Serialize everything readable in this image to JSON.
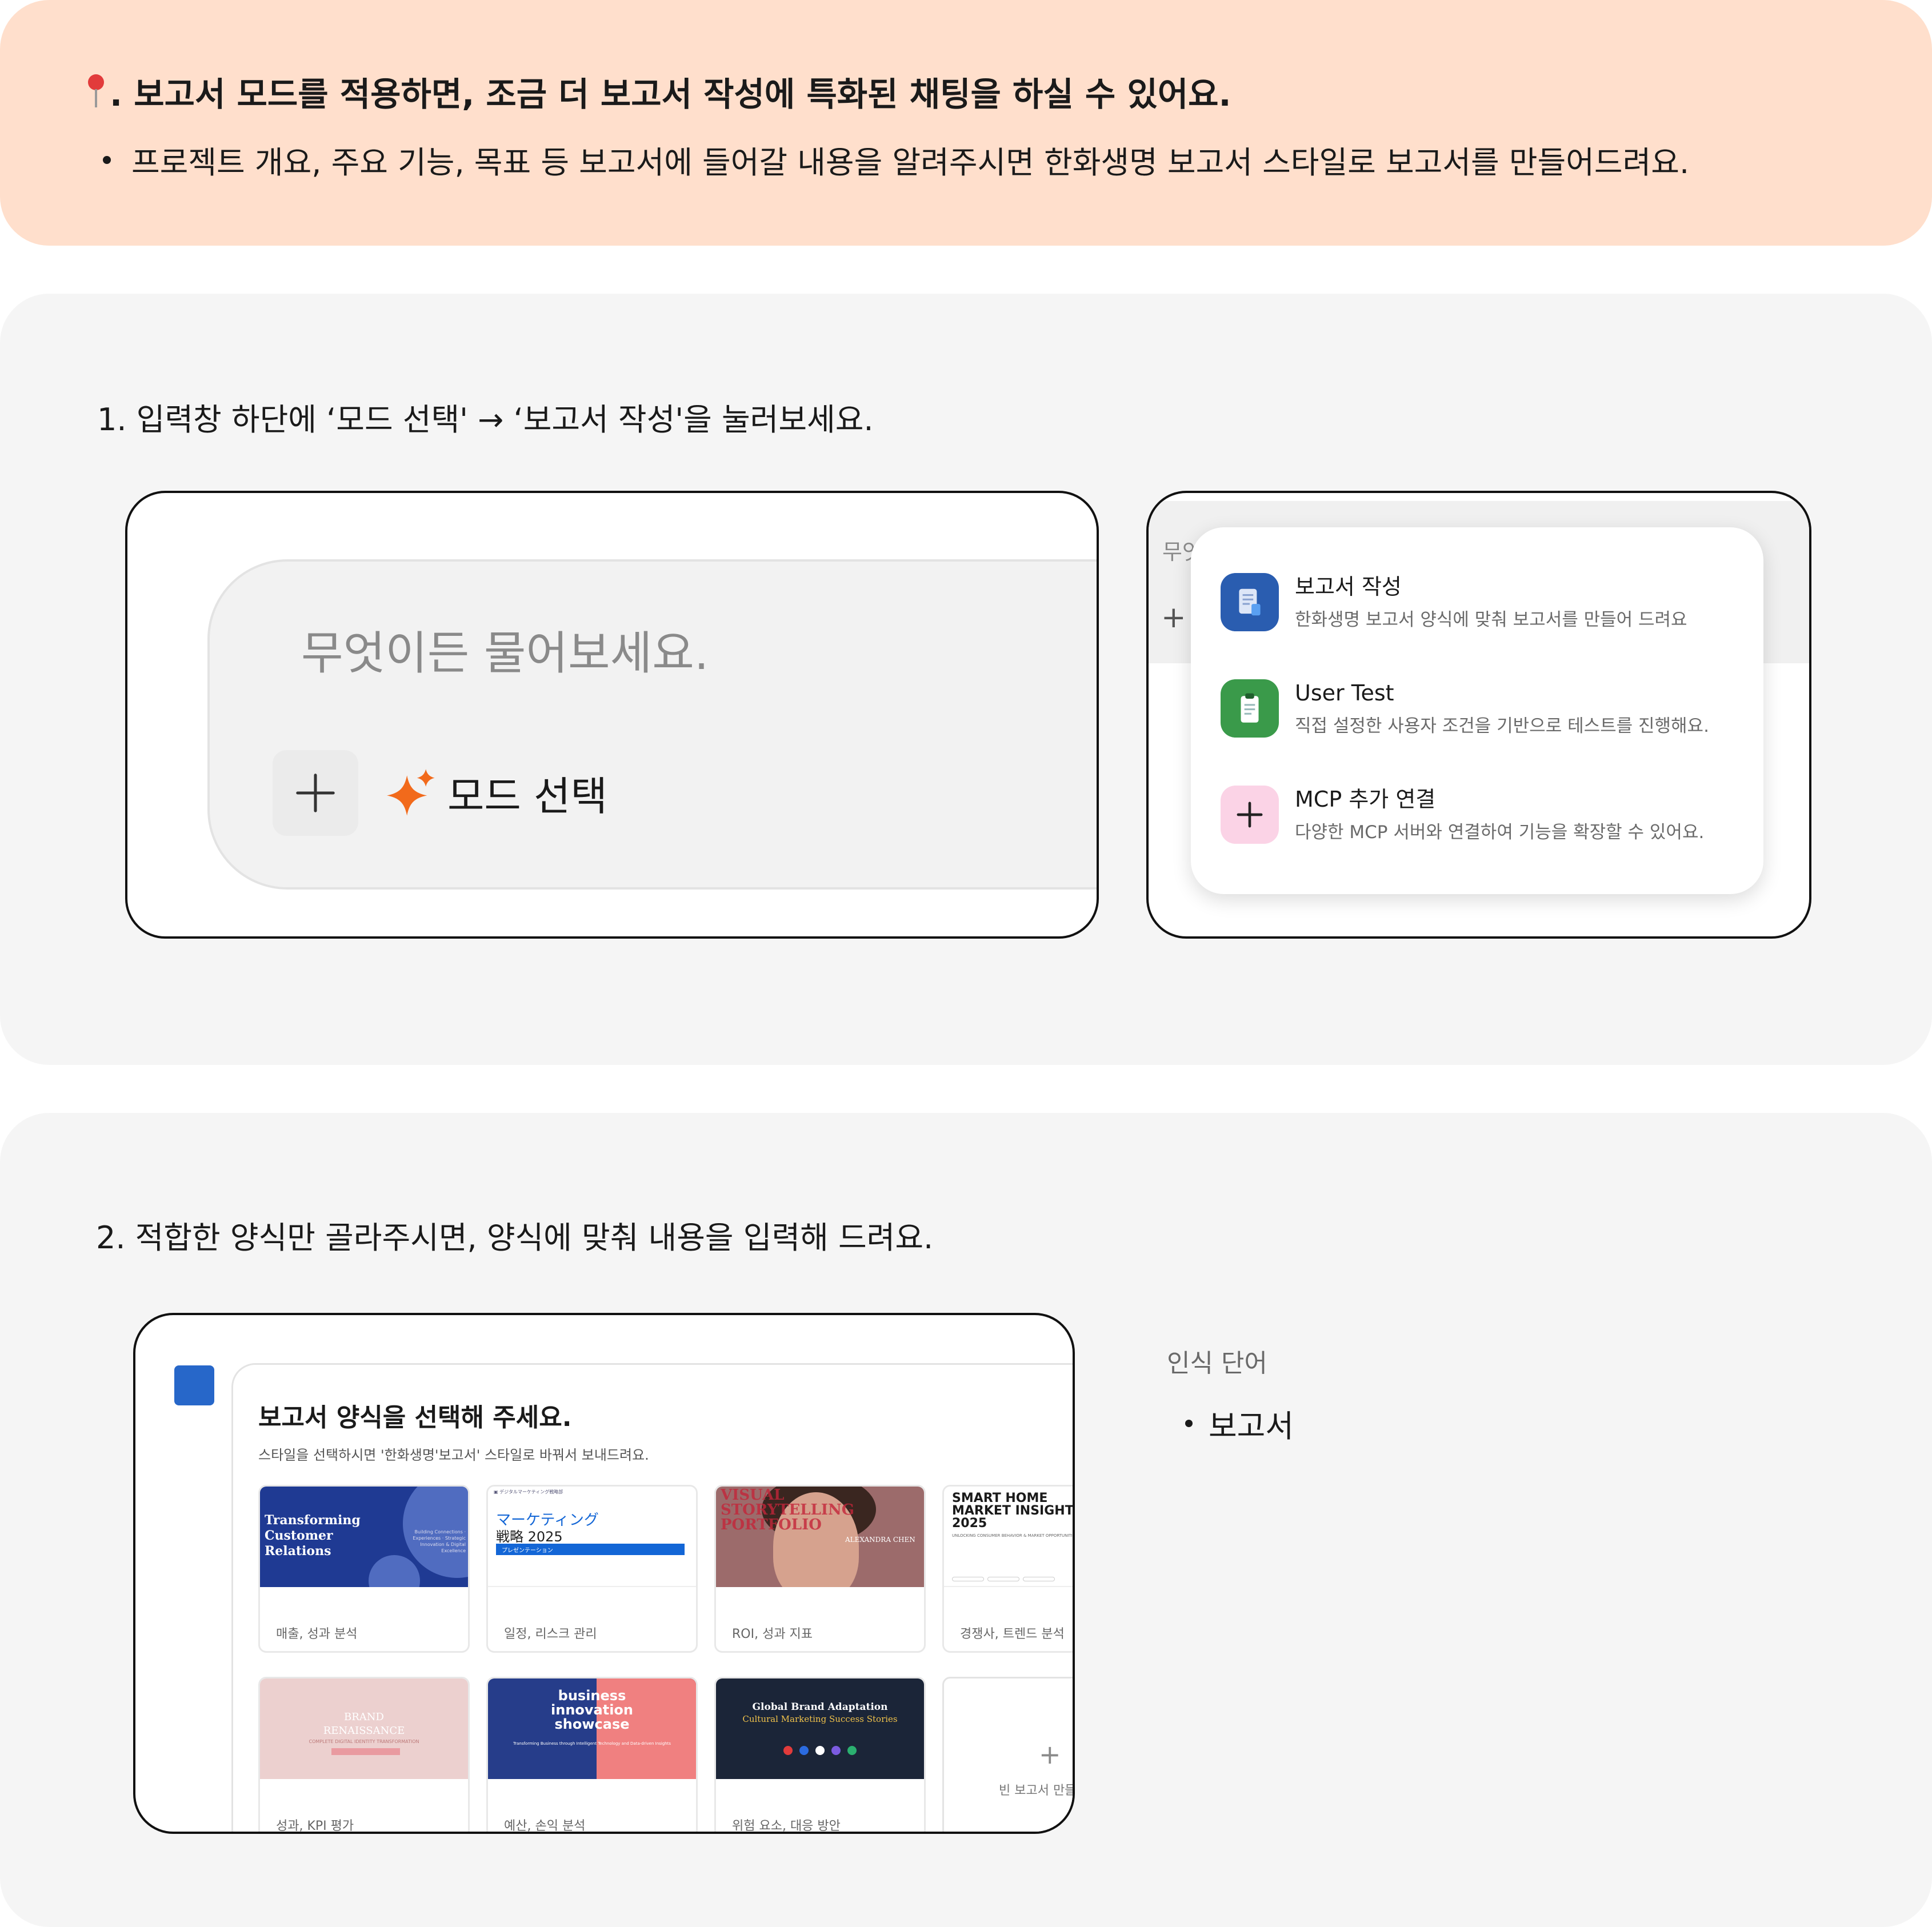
{
  "banner": {
    "title": ". 보고서 모드를 적용하면, 조금 더 보고서 작성에 특화된 채팅을 하실 수 있어요.",
    "bullet": "프로젝트 개요, 주요 기능, 목표 등 보고서에 들어갈 내용을 알려주시면 한화생명 보고서 스타일로 보고서를 만들어드려요."
  },
  "step1": {
    "text": "1. 입력창 하단에 ‘모드 선택' → ‘보고서 작성'을 눌러보세요.",
    "input_placeholder": "무엇이든 물어보세요.",
    "mode_button_label": "모드 선택",
    "bg_text": "무엇",
    "menu": [
      {
        "title": "보고서 작성",
        "desc": "한화생명 보고서 양식에 맞춰 보고서를 만들어 드려요",
        "color": "#2a5db0",
        "icon": "document-icon"
      },
      {
        "title": "User Test",
        "desc": "직접 설정한 사용자 조건을 기반으로 테스트를 진행해요.",
        "color": "#3a9a4a",
        "icon": "clipboard-icon"
      },
      {
        "title": "MCP 추가 연결",
        "desc": "다양한 MCP 서버와 연결하여 기능을 확장할 수 있어요.",
        "color": "#fbd3e6",
        "icon": "plus-icon"
      }
    ]
  },
  "step2": {
    "text": "2. 적합한 양식만 골라주시면, 양식에 맞춰 내용을 입력해 드려요.",
    "picker_title": "보고서 양식을 선택해 주세요.",
    "picker_subtitle": "스타일을 선택하시면 '한화생명'보고서' 스타일로 바꿔서 보내드려요.",
    "templates": [
      {
        "label": "매출, 성과 분석",
        "thumb_text": "Transforming\nCustomer\nRelations"
      },
      {
        "label": "일정, 리스크 관리",
        "thumb_text_1": "マーケティング",
        "thumb_text_2": "戦略 2025",
        "thumb_bar": "プレゼンテーション"
      },
      {
        "label": "ROI, 성과 지표",
        "thumb_text": "VISUAL\nSTORYTELLING\nPORTFOLIO",
        "thumb_name": "ALEXANDRA CHEN"
      },
      {
        "label": "경쟁사, 트렌드 분석",
        "thumb_text": "SMART HOME\nMARKET INSIGHTS\n2025"
      },
      {
        "label": "성과, KPI 평가",
        "thumb_text": "BRAND\nRENAISSANCE",
        "thumb_sub": "COMPLETE DIGITAL IDENTITY TRANSFORMATION"
      },
      {
        "label": "예산, 손익 분석",
        "thumb_text": "business\ninnovation\nshowcase"
      },
      {
        "label": "위험 요소, 대응 방안",
        "thumb_text_1": "Global Brand Adaptation",
        "thumb_text_2": "Cultural Marketing Success Stories"
      }
    ],
    "new_report_label": "빈 보고서 만들"
  },
  "recognized": {
    "heading": "인식 단어",
    "items": [
      "보고서"
    ]
  }
}
